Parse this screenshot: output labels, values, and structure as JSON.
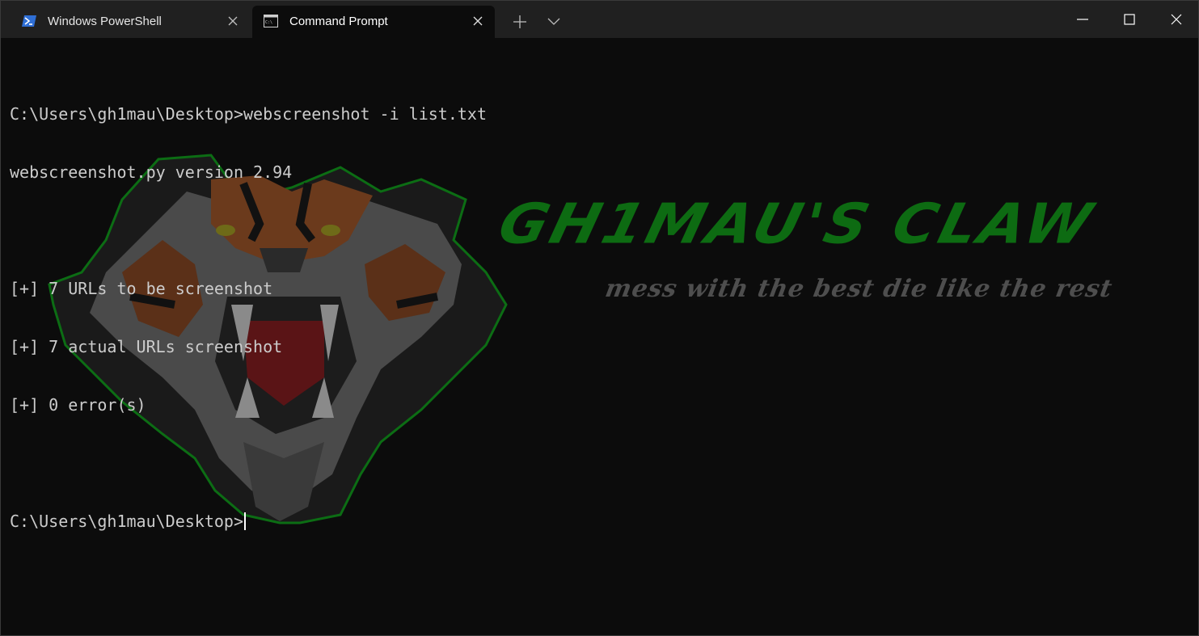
{
  "tabs": [
    {
      "label": "Windows PowerShell",
      "icon": "powershell-icon",
      "active": false
    },
    {
      "label": "Command Prompt",
      "icon": "cmd-icon",
      "active": true
    }
  ],
  "window_controls": {
    "new_tab": "plus-icon",
    "dropdown": "chevron-down-icon",
    "minimize": "minimize-icon",
    "maximize": "maximize-icon",
    "close": "close-icon"
  },
  "terminal": {
    "lines": [
      "C:\\Users\\gh1mau\\Desktop>webscreenshot -i list.txt",
      "webscreenshot.py version 2.94",
      "",
      "[+] 7 URLs to be screenshot",
      "[+] 7 actual URLs screenshot",
      "[+] 0 error(s)",
      "",
      "C:\\Users\\gh1mau\\Desktop>"
    ]
  },
  "background": {
    "brand": "GH1MAU'S CLAW",
    "slogan": "mess with the best die like the rest",
    "brand_color": "#0d6b12",
    "logo_icon": "tiger-head-icon"
  },
  "colors": {
    "titlebar": "#202020",
    "terminal_bg": "#0c0c0c",
    "text": "#cccccc"
  }
}
